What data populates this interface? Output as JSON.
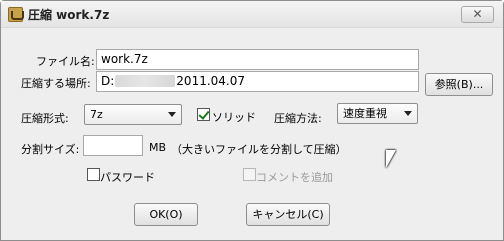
{
  "window": {
    "title": "圧縮 work.7z",
    "close_label": "✕"
  },
  "file_name": {
    "label": "ファイル名:",
    "value": "work.7z"
  },
  "location": {
    "label": "圧縮する場所:",
    "value_prefix": "D:",
    "value_suffix": "2011.04.07",
    "browse_label": "参照(B)..."
  },
  "format": {
    "label": "圧縮形式:",
    "value": "7z"
  },
  "solid": {
    "label": "ソリッド",
    "checked": true
  },
  "method": {
    "label": "圧縮方法:",
    "value": "速度重視"
  },
  "split": {
    "label": "分割サイズ:",
    "value": "",
    "unit": "MB",
    "hint": "（大きいファイルを分割して圧縮）"
  },
  "password": {
    "label": "パスワード",
    "checked": false
  },
  "comment": {
    "label": "コメントを追加",
    "enabled": false
  },
  "buttons": {
    "ok_label": "OK(O)",
    "cancel_label": "キャンセル(C)"
  }
}
